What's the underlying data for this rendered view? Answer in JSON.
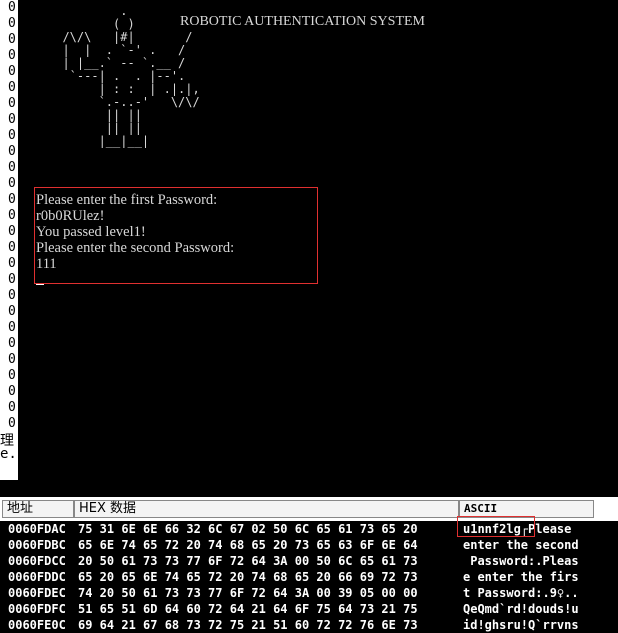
{
  "console": {
    "title": "ROBOTIC AUTHENTICATION SYSTEM",
    "art": "          .\n         ( )\n  /\\/\\   |#|       /\n  |  |  . `-' .   /\n  | |__.` -- `.__ /\n   `---| .  . |--'.\n       | : :  | .|.|,\n       `.-..-'   \\/\\/\n        || ||\n        || ||\n       |__|__|",
    "lines": [
      "Please enter the first Password:",
      "r0b0RUlez!",
      "You passed level1!",
      "Please enter the second Password:",
      "111"
    ]
  },
  "left_column": [
    "0",
    "0",
    "0",
    "0",
    "0",
    "0",
    "0",
    "0",
    "0",
    "0",
    "0",
    "0",
    "0",
    "0",
    "0",
    "0",
    "0",
    "0",
    "0",
    "0",
    "0",
    "0",
    "0",
    "0",
    "0",
    "0",
    "0"
  ],
  "left_bar_text": [
    "理",
    "e."
  ],
  "dump": {
    "headers": {
      "addr": "地址",
      "hex": "HEX 数据",
      "ascii": "ASCII"
    },
    "rows": [
      {
        "addr": "0060FDAC",
        "hex": "75 31 6E 6E 66 32 6C 67 02 50 6C 65 61 73 65 20",
        "ascii": "u1nnf2lg┌Please "
      },
      {
        "addr": "0060FDBC",
        "hex": "65 6E 74 65 72 20 74 68 65 20 73 65 63 6F 6E 64",
        "ascii": "enter the second"
      },
      {
        "addr": "0060FDCC",
        "hex": "20 50 61 73 73 77 6F 72 64 3A 00 50 6C 65 61 73",
        "ascii": " Password:.Pleas"
      },
      {
        "addr": "0060FDDC",
        "hex": "65 20 65 6E 74 65 72 20 74 68 65 20 66 69 72 73",
        "ascii": "e enter the firs"
      },
      {
        "addr": "0060FDEC",
        "hex": "74 20 50 61 73 73 77 6F 72 64 3A 00 39 05 00 00",
        "ascii": "t Password:.9♀.."
      },
      {
        "addr": "0060FDFC",
        "hex": "51 65 51 6D 64 60 72 64 21 64 6F 75 64 73 21 75",
        "ascii": "QeQmd`rd!douds!u"
      },
      {
        "addr": "0060FE0C",
        "hex": "69 64 21 67 68 73 72 75 21 51 60 72 72 76 6E 73",
        "ascii": "id!ghsru!Q`rrvns"
      }
    ]
  }
}
